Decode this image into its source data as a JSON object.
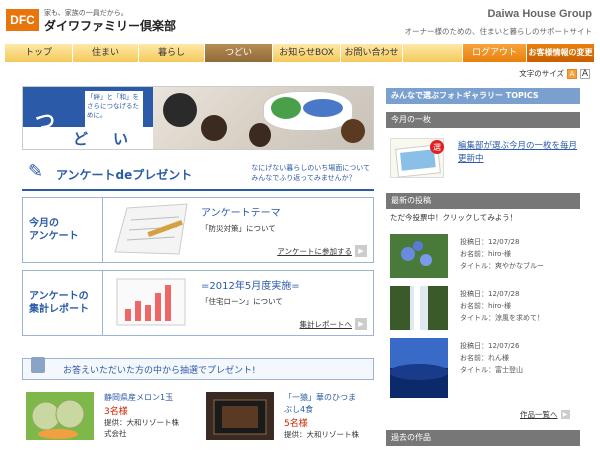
{
  "header": {
    "logo_abbr": "DFC",
    "logo_tagline": "家も、家族の一員だから。",
    "logo_name": "ダイワファミリー倶楽部",
    "brand": "Daiwa House Group",
    "brand_tagline": "オーナー様のための、住まいと暮らしのサポートサイト"
  },
  "nav": {
    "items": [
      {
        "label": "トップ"
      },
      {
        "label": "住まい"
      },
      {
        "label": "暮らし"
      },
      {
        "label": "つどい"
      },
      {
        "label": "お知らせBOX"
      },
      {
        "label": "お問い合わせ"
      },
      {
        "label": "ログアウト"
      },
      {
        "label": "お客様情報の変更"
      }
    ]
  },
  "font_size": {
    "label": "文字のサイズ",
    "small": "A",
    "large": "A"
  },
  "hero": {
    "title_big": "つ",
    "title_chars": [
      "ど",
      "い"
    ],
    "subtitle": "「絆」と「和」をさらにつなげるために。"
  },
  "enquete": {
    "title": "アンケートdeプレゼント",
    "desc_line1": "なにげない暮らしのいち場面について",
    "desc_line2": "みんなでふり返ってみませんか？"
  },
  "this_month": {
    "label_line1": "今月の",
    "label_line2": "アンケート",
    "theme_title": "アンケートテーマ",
    "theme_body": "「防災対策」について",
    "link": "アンケートに参加する"
  },
  "report": {
    "label_line1": "アンケートの",
    "label_line2": "集計レポート",
    "title": "=2012年5月度実施=",
    "body": "「住宅ローン」について",
    "link": "集計レポートへ"
  },
  "present": {
    "text": "お答えいただいた方の中から抽選でプレゼント!"
  },
  "prizes": [
    {
      "name": "静岡県産メロン1玉",
      "count": "3名様",
      "src_line1": "提供：大和リゾート株",
      "src_line2": "式会社"
    },
    {
      "name_line1": "「一猿」華のひつま",
      "name_line2": "ぶし4食",
      "count": "5名様",
      "src_line1": "提供：大和リゾート株"
    }
  ],
  "sidebar": {
    "gallery_title": "みんなで選ぶフォトギャラリー TOPICS",
    "monthly_title": "今月の一枚",
    "monthly_badge": "選",
    "monthly_text": "編集部が選ぶ今月の一枚を毎月更新中",
    "recent_title": "最新の投稿",
    "recent_intro": "ただ今投票中！クリックしてみよう！",
    "posts": [
      {
        "date": "投稿日：12/07/28",
        "name": "お名前：hiro-様",
        "title": "タイトル：爽やかなブルー"
      },
      {
        "date": "投稿日：12/07/28",
        "name": "お名前：hiro-様",
        "title": "タイトル：涼風を求めて！"
      },
      {
        "date": "投稿日：12/07/26",
        "name": "お名前：れん様",
        "title": "タイトル：富士登山"
      }
    ],
    "list_link": "作品一覧へ",
    "past_title": "過去の作品"
  }
}
